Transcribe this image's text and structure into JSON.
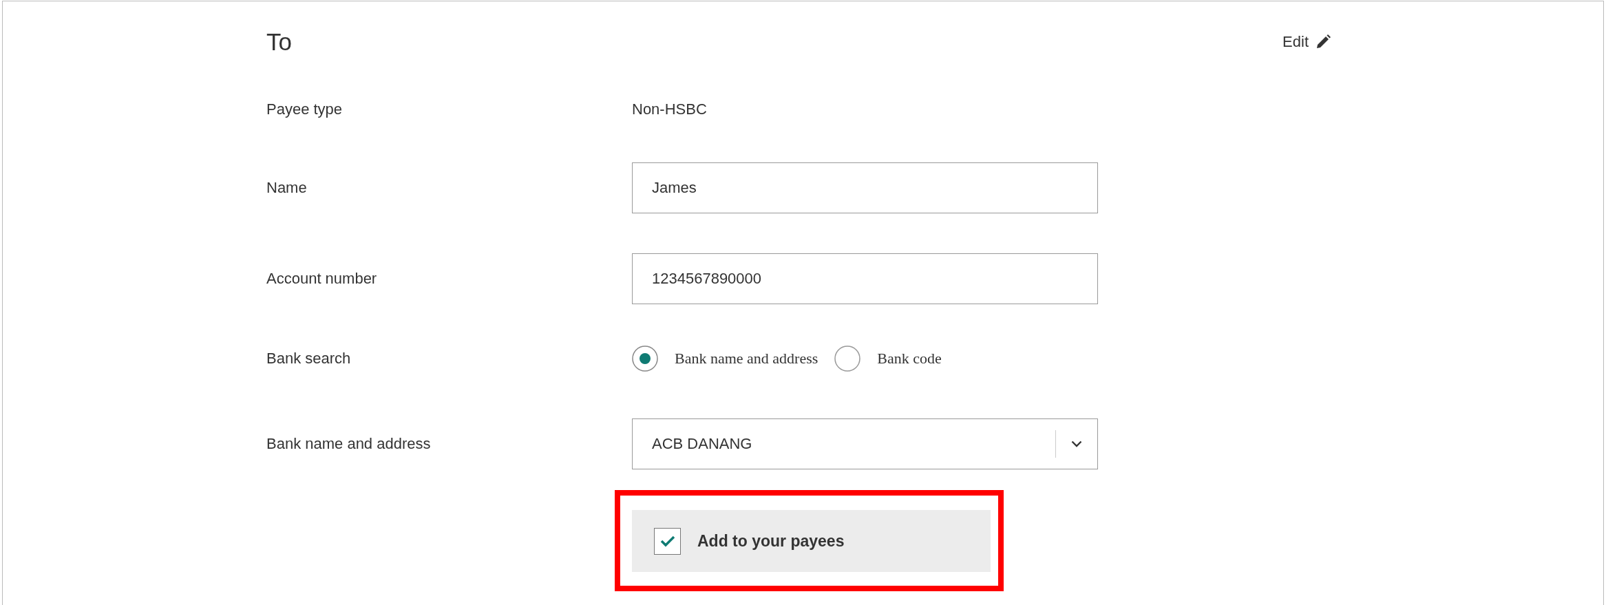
{
  "heading": "To",
  "edit_link": "Edit",
  "fields": [
    {
      "kind": "text",
      "label": "Payee type",
      "value": "Non-HSBC"
    },
    {
      "kind": "input",
      "label": "Name",
      "value": "James"
    },
    {
      "kind": "input",
      "label": "Account number",
      "value": "1234567890000"
    },
    {
      "kind": "radio",
      "label": "Bank search",
      "options": [
        {
          "label": "Bank name and address",
          "selected": true
        },
        {
          "label": "Bank code",
          "selected": false
        }
      ]
    },
    {
      "kind": "select",
      "label": "Bank name and address",
      "value": "ACB DANANG"
    }
  ],
  "add_to_payees": {
    "label": "Add to your payees",
    "checked": true
  }
}
